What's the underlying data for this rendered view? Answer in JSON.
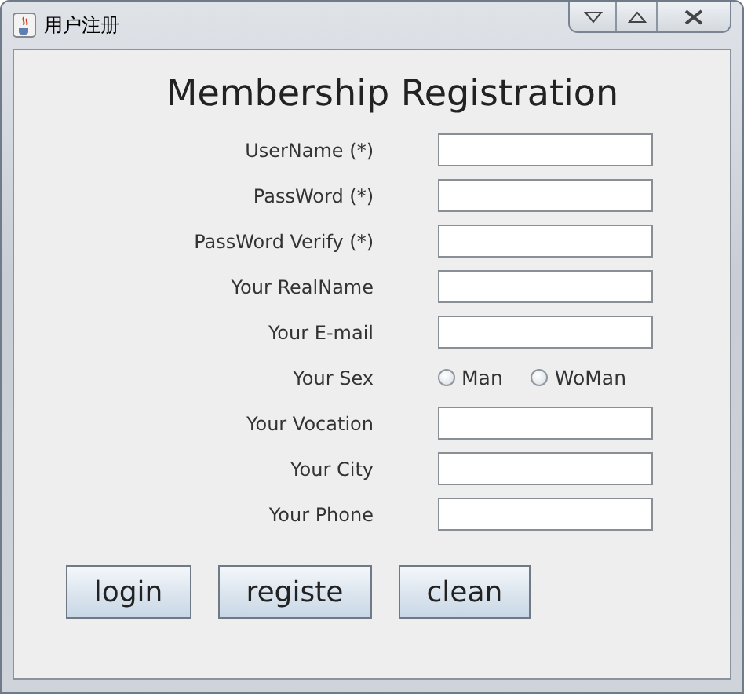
{
  "window": {
    "title": "用户注册"
  },
  "heading": "Membership Registration",
  "fields": [
    {
      "kind": "text",
      "label": "UserName (*)"
    },
    {
      "kind": "text",
      "label": "PassWord (*)"
    },
    {
      "kind": "text",
      "label": "PassWord Verify (*)"
    },
    {
      "kind": "text",
      "label": "Your RealName"
    },
    {
      "kind": "text",
      "label": "Your E-mail"
    },
    {
      "kind": "radio",
      "label": "Your Sex",
      "options": [
        {
          "label": "Man",
          "selected": false
        },
        {
          "label": "WoMan",
          "selected": false
        }
      ]
    },
    {
      "kind": "text",
      "label": "Your Vocation"
    },
    {
      "kind": "text",
      "label": "Your City"
    },
    {
      "kind": "text",
      "label": "Your Phone"
    }
  ],
  "buttons": [
    "login",
    "registe",
    "clean"
  ]
}
